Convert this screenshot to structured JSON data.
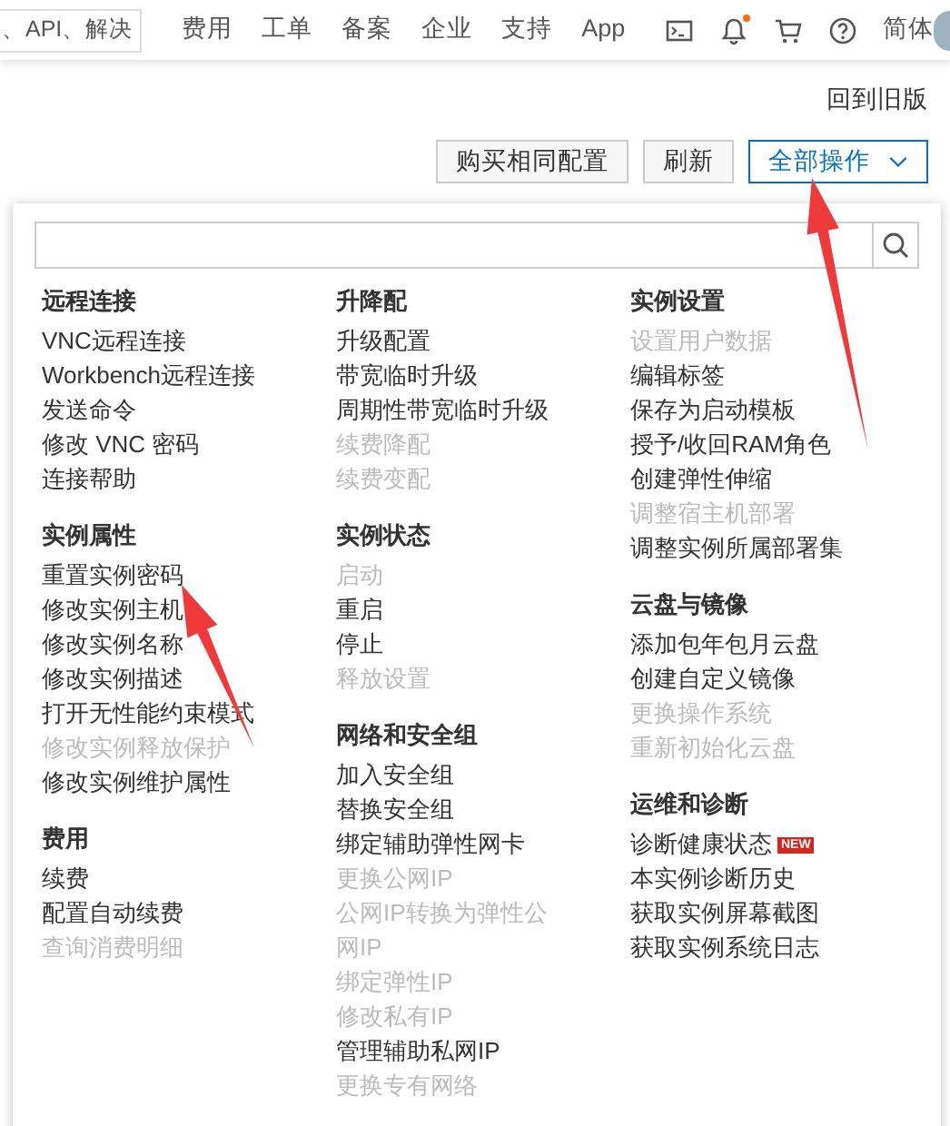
{
  "topbar": {
    "search": {
      "value": "、API、解决"
    },
    "nav": [
      "费用",
      "工单",
      "备案",
      "企业",
      "支持",
      "App"
    ],
    "bell": {
      "unread": true
    },
    "language": "简体"
  },
  "legacy_link": "回到旧版",
  "buttons": [
    {
      "label": "购买相同配置",
      "kind": "plain"
    },
    {
      "label": "刷新",
      "kind": "plain"
    },
    {
      "label": "全部操作",
      "kind": "dropdown",
      "expanded": true
    }
  ],
  "menu": {
    "columns": [
      [
        {
          "title": "远程连接",
          "items": [
            {
              "label": "VNC远程连接",
              "disabled": false
            },
            {
              "label": "Workbench远程连接",
              "disabled": false
            },
            {
              "label": "发送命令",
              "disabled": false
            },
            {
              "label": "修改 VNC 密码",
              "disabled": false
            },
            {
              "label": "连接帮助",
              "disabled": false
            }
          ]
        },
        {
          "title": "实例属性",
          "items": [
            {
              "label": "重置实例密码",
              "disabled": false
            },
            {
              "label": "修改实例主机",
              "disabled": false
            },
            {
              "label": "修改实例名称",
              "disabled": false
            },
            {
              "label": "修改实例描述",
              "disabled": false
            },
            {
              "label": "打开无性能约束模式",
              "disabled": false
            },
            {
              "label": "修改实例释放保护",
              "disabled": true
            },
            {
              "label": "修改实例维护属性",
              "disabled": false
            }
          ]
        },
        {
          "title": "费用",
          "items": [
            {
              "label": "续费",
              "disabled": false
            },
            {
              "label": "配置自动续费",
              "disabled": false
            },
            {
              "label": "查询消费明细",
              "disabled": true
            }
          ]
        }
      ],
      [
        {
          "title": "升降配",
          "items": [
            {
              "label": "升级配置",
              "disabled": false
            },
            {
              "label": "带宽临时升级",
              "disabled": false
            },
            {
              "label": "周期性带宽临时升级",
              "disabled": false
            },
            {
              "label": "续费降配",
              "disabled": true
            },
            {
              "label": "续费变配",
              "disabled": true
            }
          ]
        },
        {
          "title": "实例状态",
          "items": [
            {
              "label": "启动",
              "disabled": true
            },
            {
              "label": "重启",
              "disabled": false
            },
            {
              "label": "停止",
              "disabled": false
            },
            {
              "label": "释放设置",
              "disabled": true
            }
          ]
        },
        {
          "title": "网络和安全组",
          "items": [
            {
              "label": "加入安全组",
              "disabled": false
            },
            {
              "label": "替换安全组",
              "disabled": false
            },
            {
              "label": "绑定辅助弹性网卡",
              "disabled": false
            },
            {
              "label": "更换公网IP",
              "disabled": true
            },
            {
              "label": "公网IP转换为弹性公网IP",
              "disabled": true
            },
            {
              "label": "绑定弹性IP",
              "disabled": true
            },
            {
              "label": "修改私有IP",
              "disabled": true
            },
            {
              "label": "管理辅助私网IP",
              "disabled": false
            },
            {
              "label": "更换专有网络",
              "disabled": true
            }
          ]
        }
      ],
      [
        {
          "title": "实例设置",
          "items": [
            {
              "label": "设置用户数据",
              "disabled": true
            },
            {
              "label": "编辑标签",
              "disabled": false
            },
            {
              "label": "保存为启动模板",
              "disabled": false
            },
            {
              "label": "授予/收回RAM角色",
              "disabled": false
            },
            {
              "label": "创建弹性伸缩",
              "disabled": false
            },
            {
              "label": "调整宿主机部署",
              "disabled": true
            },
            {
              "label": "调整实例所属部署集",
              "disabled": false
            }
          ]
        },
        {
          "title": "云盘与镜像",
          "items": [
            {
              "label": "添加包年包月云盘",
              "disabled": false
            },
            {
              "label": "创建自定义镜像",
              "disabled": false
            },
            {
              "label": "更换操作系统",
              "disabled": true
            },
            {
              "label": "重新初始化云盘",
              "disabled": true
            }
          ]
        },
        {
          "title": "运维和诊断",
          "items": [
            {
              "label": "诊断健康状态",
              "disabled": false,
              "badge": "NEW"
            },
            {
              "label": "本实例诊断历史",
              "disabled": false
            },
            {
              "label": "获取实例屏幕截图",
              "disabled": false
            },
            {
              "label": "获取实例系统日志",
              "disabled": false
            }
          ]
        }
      ]
    ]
  }
}
